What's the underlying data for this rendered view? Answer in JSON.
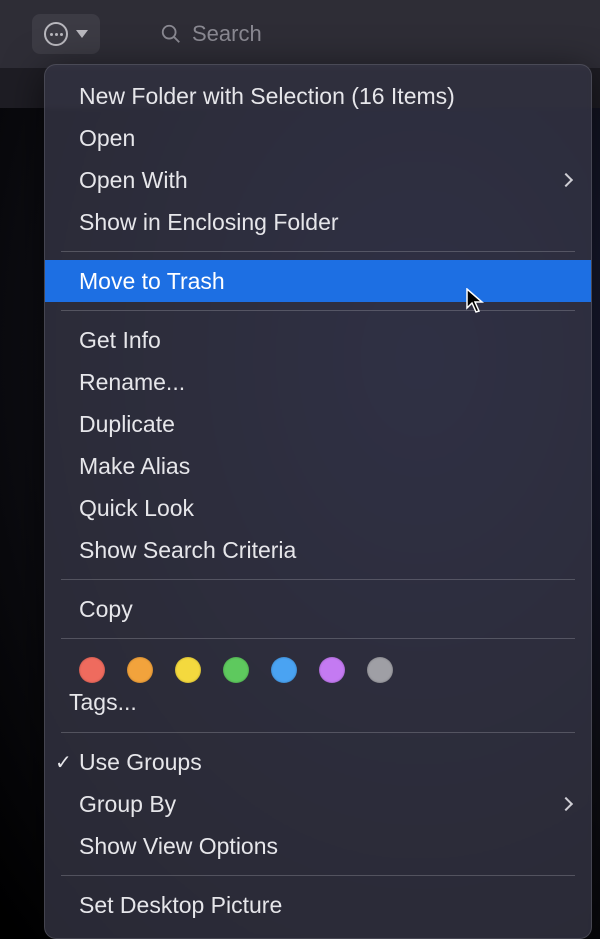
{
  "search": {
    "placeholder": "Search"
  },
  "menu": {
    "group1": [
      {
        "label": "New Folder with Selection (16 Items)",
        "submenu": false
      },
      {
        "label": "Open",
        "submenu": false
      },
      {
        "label": "Open With",
        "submenu": true
      },
      {
        "label": "Show in Enclosing Folder",
        "submenu": false
      }
    ],
    "group2": [
      {
        "label": "Move to Trash",
        "highlighted": true
      }
    ],
    "group3": [
      {
        "label": "Get Info"
      },
      {
        "label": "Rename..."
      },
      {
        "label": "Duplicate"
      },
      {
        "label": "Make Alias"
      },
      {
        "label": "Quick Look"
      },
      {
        "label": "Show Search Criteria"
      }
    ],
    "group4": [
      {
        "label": "Copy"
      }
    ],
    "tags_label": "Tags...",
    "tag_colors": [
      "#ef6b5e",
      "#f2a33c",
      "#f4d93e",
      "#5ec95e",
      "#4aa3f2",
      "#c47af2",
      "#9f9fa5"
    ],
    "group5": [
      {
        "label": "Use Groups",
        "checked": true,
        "submenu": false
      },
      {
        "label": "Group By",
        "submenu": true
      },
      {
        "label": "Show View Options",
        "submenu": false
      }
    ],
    "group6": [
      {
        "label": "Set Desktop Picture"
      }
    ]
  }
}
